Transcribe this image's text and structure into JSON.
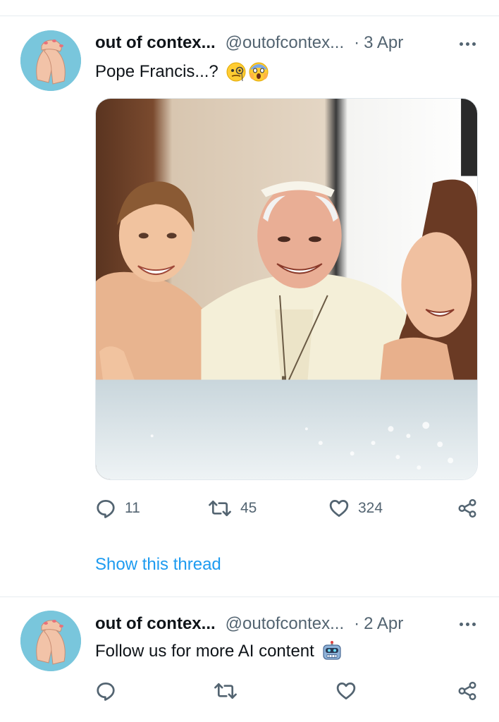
{
  "tweets": [
    {
      "display_name": "out of contex...",
      "handle": "@outofcontex...",
      "separator": "·",
      "date": "3 Apr",
      "text": "Pope Francis...?",
      "emojis": [
        "face-with-monocle-emoji",
        "face-screaming-in-fear-emoji"
      ],
      "media": "photo-pope-in-hot-tub",
      "actions": {
        "replies": "11",
        "retweets": "45",
        "likes": "324"
      },
      "thread_link": "Show this thread"
    },
    {
      "display_name": "out of contex...",
      "handle": "@outofcontex...",
      "separator": "·",
      "date": "2 Apr",
      "text": "Follow us for more AI content",
      "emojis": [
        "robot-emoji"
      ],
      "actions": {
        "replies": "",
        "retweets": "",
        "likes": ""
      }
    }
  ],
  "colors": {
    "primary_text": "#0f1419",
    "secondary_text": "#536471",
    "link": "#1d9bf0",
    "divider": "#e6ecf0",
    "avatar_bg": "#79c6dc"
  },
  "icons": [
    "reply-icon",
    "retweet-icon",
    "like-icon",
    "share-icon",
    "more-options-icon"
  ]
}
